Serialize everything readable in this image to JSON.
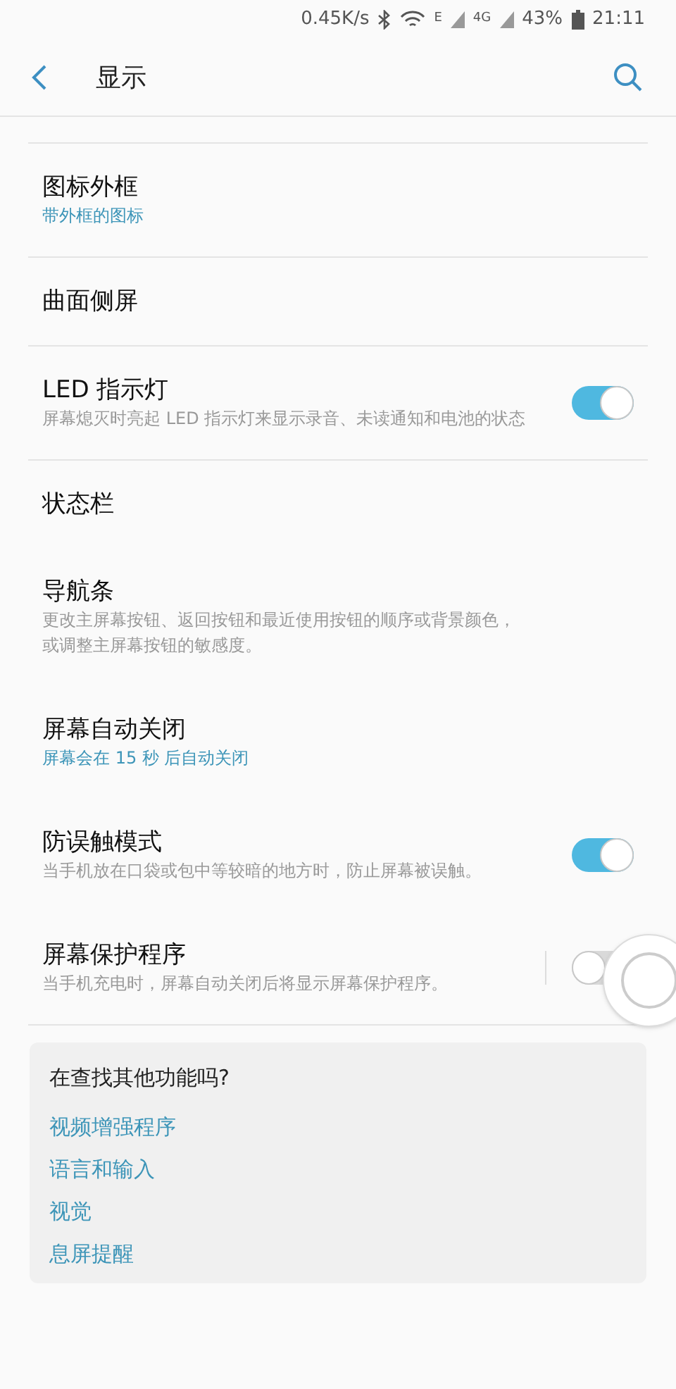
{
  "status_bar": {
    "speed": "0.45K/s",
    "net1": "E",
    "net2": "4G",
    "battery": "43%",
    "time": "21:11"
  },
  "header": {
    "title": "显示"
  },
  "items": [
    {
      "kind": "plain",
      "title": "图标外框",
      "subtitle": "带外框的图标",
      "subtitle_accent": true,
      "divider": true
    },
    {
      "kind": "plain",
      "title": "曲面侧屏",
      "divider": true
    },
    {
      "kind": "toggle",
      "title": "LED 指示灯",
      "subtitle": "屏幕熄灭时亮起 LED 指示灯来显示录音、未读通知和电池的状态",
      "subtitle_accent": false,
      "on": true,
      "split": false,
      "divider": true
    },
    {
      "kind": "plain",
      "title": "状态栏",
      "divider": false
    },
    {
      "kind": "plain",
      "title": "导航条",
      "subtitle": "更改主屏幕按钮、返回按钮和最近使用按钮的顺序或背景颜色，或调整主屏幕按钮的敏感度。",
      "subtitle_accent": false,
      "divider": false
    },
    {
      "kind": "plain",
      "title": "屏幕自动关闭",
      "subtitle": "屏幕会在 15 秒 后自动关闭",
      "subtitle_accent": true,
      "divider": false
    },
    {
      "kind": "toggle",
      "title": "防误触模式",
      "subtitle": "当手机放在口袋或包中等较暗的地方时，防止屏幕被误触。",
      "subtitle_accent": false,
      "on": true,
      "split": false,
      "divider": false
    },
    {
      "kind": "toggle",
      "title": "屏幕保护程序",
      "subtitle": "当手机充电时，屏幕自动关闭后将显示屏幕保护程序。",
      "subtitle_accent": false,
      "on": false,
      "split": true,
      "divider": true
    }
  ],
  "suggestions": {
    "title": "在查找其他功能吗?",
    "links": [
      "视频增强程序",
      "语言和输入",
      "视觉",
      "息屏提醒"
    ]
  }
}
